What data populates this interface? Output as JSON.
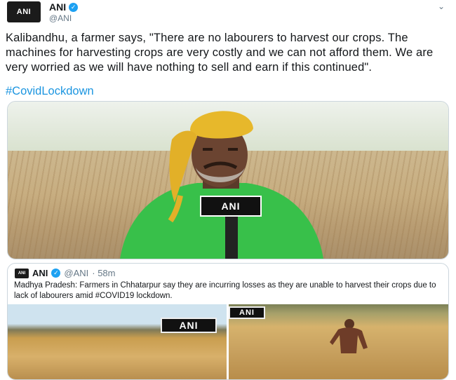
{
  "author": {
    "name": "ANI",
    "handle": "@ANI",
    "avatar_text": "ANI"
  },
  "tweet": {
    "text": "Kalibandhu, a farmer says, \"There are no labourers to harvest our crops. The machines for harvesting crops are very costly and we can not afford them. We are very worried as we will have nothing to sell and earn if this continued\".",
    "hashtag": "#CovidLockdown"
  },
  "media": {
    "mic_logo": "ANI"
  },
  "quoted": {
    "name": "ANI",
    "handle": "@ANI",
    "time": "· 58m",
    "text": "Madhya Pradesh: Farmers in Chhatarpur say they are incurring losses as they are unable to harvest their crops due to lack of labourers amid #COVID19 lockdown.",
    "badge1": "ANI",
    "badge2": "ANI"
  },
  "icons": [
    "verified-badge-icon",
    "chevron-down-icon"
  ],
  "colors": {
    "link": "#1b95e0",
    "verified": "#1da1f2"
  }
}
